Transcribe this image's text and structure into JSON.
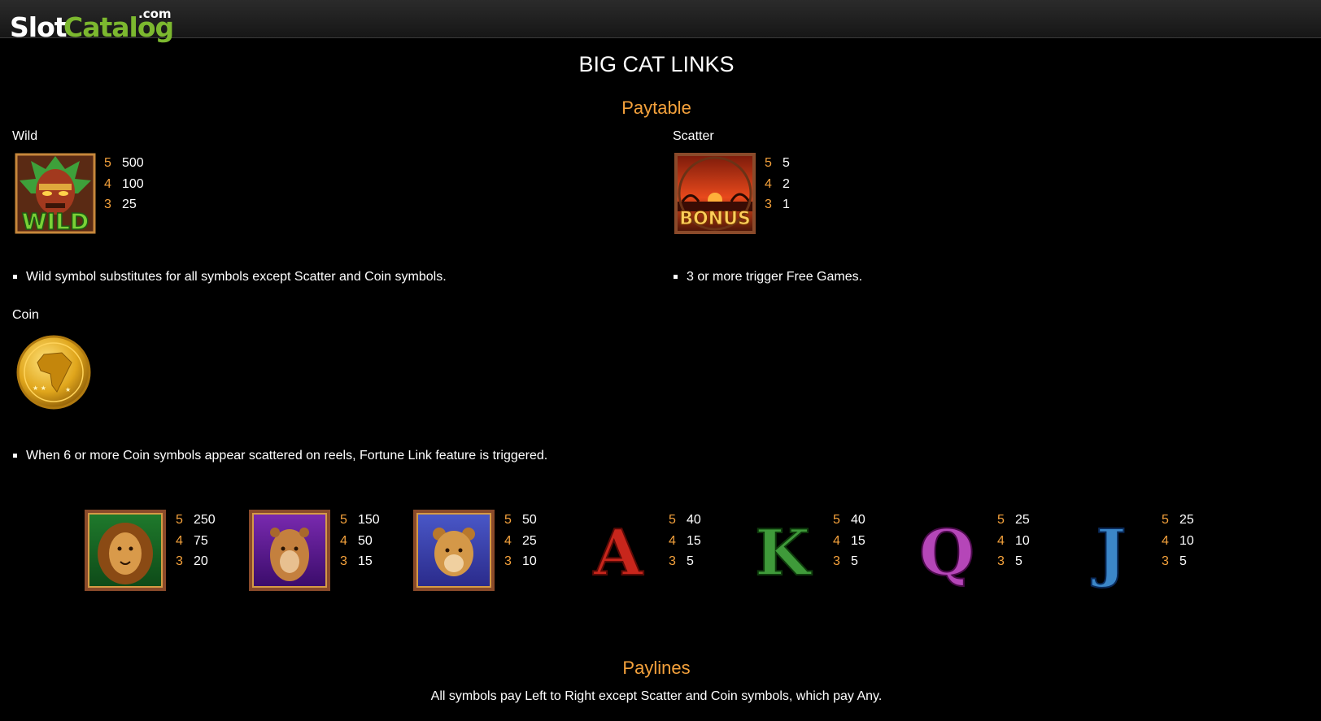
{
  "site": {
    "logo_slot": "Slot",
    "logo_catalog": "Catalog",
    "logo_com": ".com"
  },
  "page": {
    "title": "BIG CAT LINKS",
    "paytable_heading": "Paytable",
    "paylines_heading": "Paylines",
    "paylines_text": "All symbols pay Left to Right except Scatter and Coin symbols, which pay Any."
  },
  "wild": {
    "label": "Wild",
    "icon_text": "WILD",
    "pays": [
      {
        "count": "5",
        "value": "500"
      },
      {
        "count": "4",
        "value": "100"
      },
      {
        "count": "3",
        "value": "25"
      }
    ],
    "note": "Wild symbol substitutes for all symbols except Scatter and Coin symbols."
  },
  "scatter": {
    "label": "Scatter",
    "icon_text": "BONUS",
    "pays": [
      {
        "count": "5",
        "value": "5"
      },
      {
        "count": "4",
        "value": "2"
      },
      {
        "count": "3",
        "value": "1"
      }
    ],
    "note": "3 or more trigger Free Games."
  },
  "coin": {
    "label": "Coin",
    "note": "When 6 or more Coin symbols appear scattered on reels, Fortune Link feature is triggered."
  },
  "symbols": [
    {
      "name": "lion",
      "pays": [
        {
          "count": "5",
          "value": "250"
        },
        {
          "count": "4",
          "value": "75"
        },
        {
          "count": "3",
          "value": "20"
        }
      ]
    },
    {
      "name": "lioness",
      "pays": [
        {
          "count": "5",
          "value": "150"
        },
        {
          "count": "4",
          "value": "50"
        },
        {
          "count": "3",
          "value": "15"
        }
      ]
    },
    {
      "name": "cub",
      "pays": [
        {
          "count": "5",
          "value": "50"
        },
        {
          "count": "4",
          "value": "25"
        },
        {
          "count": "3",
          "value": "10"
        }
      ]
    },
    {
      "name": "A",
      "letter": "A",
      "color": "#c8261c",
      "pays": [
        {
          "count": "5",
          "value": "40"
        },
        {
          "count": "4",
          "value": "15"
        },
        {
          "count": "3",
          "value": "5"
        }
      ]
    },
    {
      "name": "K",
      "letter": "K",
      "color": "#3f9a3a",
      "pays": [
        {
          "count": "5",
          "value": "40"
        },
        {
          "count": "4",
          "value": "15"
        },
        {
          "count": "3",
          "value": "5"
        }
      ]
    },
    {
      "name": "Q",
      "letter": "Q",
      "color": "#b546b8",
      "pays": [
        {
          "count": "5",
          "value": "25"
        },
        {
          "count": "4",
          "value": "10"
        },
        {
          "count": "3",
          "value": "5"
        }
      ]
    },
    {
      "name": "J",
      "letter": "J",
      "color": "#3b86c8",
      "pays": [
        {
          "count": "5",
          "value": "25"
        },
        {
          "count": "4",
          "value": "10"
        },
        {
          "count": "3",
          "value": "5"
        }
      ]
    }
  ],
  "colors": {
    "accent": "#f5a23c",
    "brand_green": "#7cb82f"
  }
}
